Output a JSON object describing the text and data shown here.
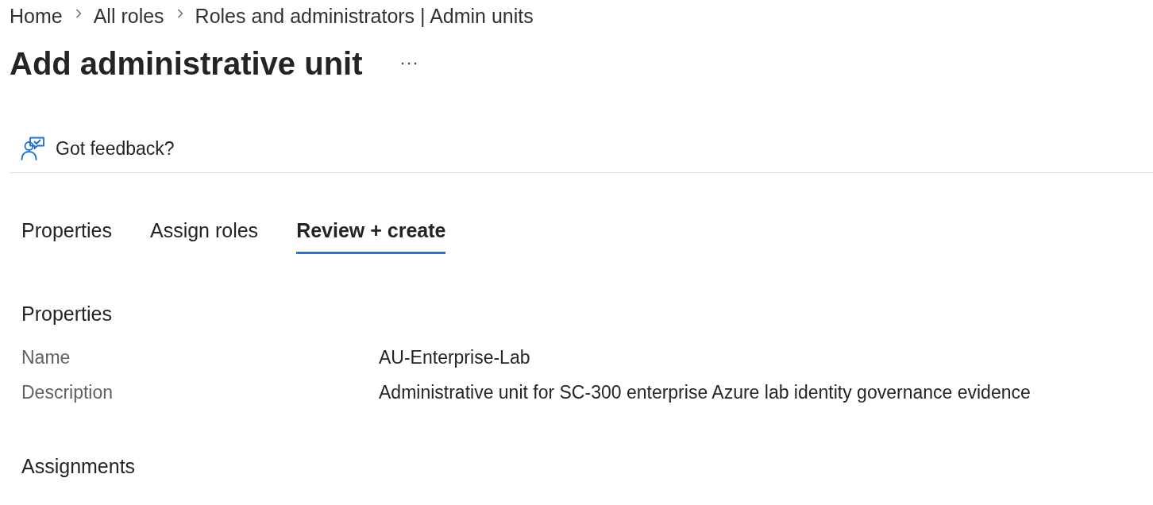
{
  "breadcrumb": [
    {
      "label": "Home"
    },
    {
      "label": "All roles"
    },
    {
      "label": "Roles and administrators | Admin units"
    }
  ],
  "page_title": "Add administrative unit",
  "toolbar": {
    "feedback": "Got feedback?"
  },
  "tabs": [
    {
      "label": "Properties",
      "selected": false
    },
    {
      "label": "Assign roles",
      "selected": false
    },
    {
      "label": "Review + create",
      "selected": true
    }
  ],
  "sections": [
    {
      "title": "Properties",
      "fields": [
        {
          "label": "Name",
          "value": "AU-Enterprise-Lab"
        },
        {
          "label": "Description",
          "value": "Administrative unit for SC-300 enterprise Azure lab identity governance evidence"
        }
      ]
    },
    {
      "title": "Assignments"
    }
  ]
}
